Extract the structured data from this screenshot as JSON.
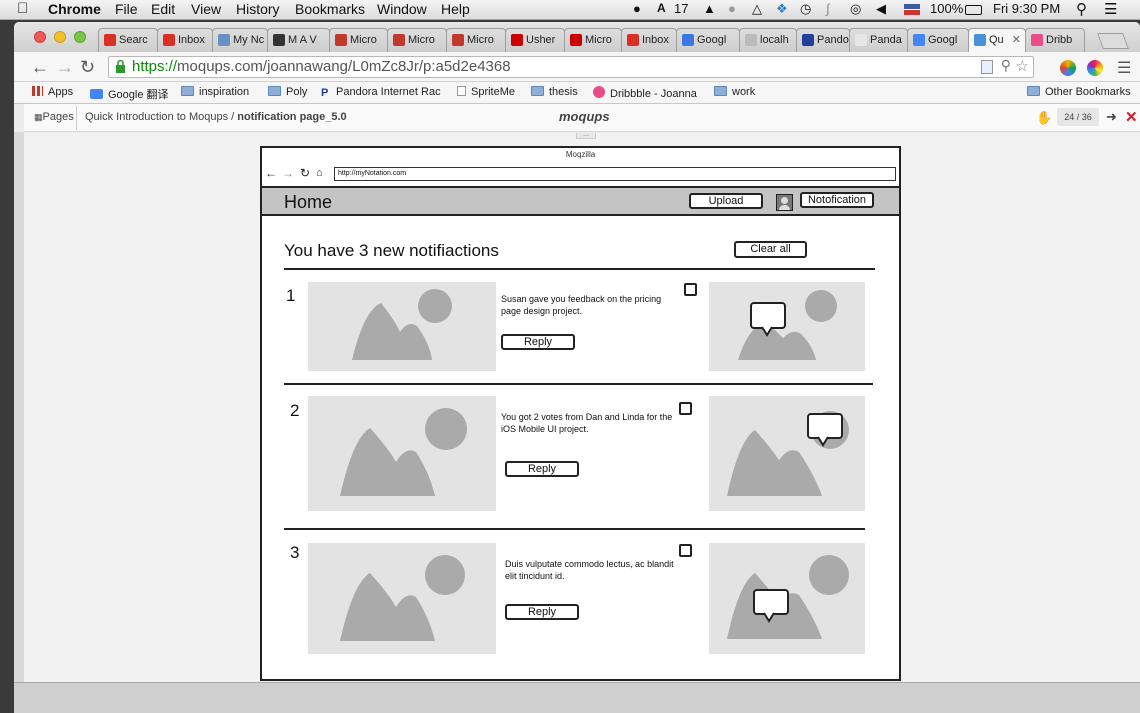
{
  "menubar": {
    "app": "Chrome",
    "menus": [
      "File",
      "Edit",
      "View",
      "History",
      "Bookmarks",
      "Window",
      "Help"
    ],
    "adobe_count": "17",
    "battery": "100%",
    "clock": "Fri 9:30 PM"
  },
  "tabs": [
    {
      "label": "Searc",
      "icon": "gmail-icon",
      "color": "#d93025"
    },
    {
      "label": "Inbox",
      "icon": "gmail-icon",
      "color": "#d93025"
    },
    {
      "label": "My Nc",
      "icon": "mynotation-icon",
      "color": "#6a8fc7"
    },
    {
      "label": "M A V",
      "icon": "mav-icon",
      "color": "#333333"
    },
    {
      "label": "Micro",
      "icon": "gear-icon",
      "color": "#c0392b"
    },
    {
      "label": "Micro",
      "icon": "gear-icon",
      "color": "#c0392b"
    },
    {
      "label": "Micro",
      "icon": "gear-icon",
      "color": "#c0392b"
    },
    {
      "label": "Usher",
      "icon": "youtube-icon",
      "color": "#cc0000"
    },
    {
      "label": "Micro",
      "icon": "youtube-icon",
      "color": "#cc0000"
    },
    {
      "label": "Inbox",
      "icon": "gmail-icon",
      "color": "#d93025"
    },
    {
      "label": "Googl",
      "icon": "calendar-icon",
      "color": "#3b78e7"
    },
    {
      "label": "localh",
      "icon": "page-icon",
      "color": "#bbbbbb"
    },
    {
      "label": "Pando",
      "icon": "pandora-icon",
      "color": "#224099"
    },
    {
      "label": "Panda",
      "icon": "page-icon",
      "color": "#e6e6e6"
    },
    {
      "label": "Googl",
      "icon": "translate-icon",
      "color": "#4285f4"
    },
    {
      "label": "Qu",
      "icon": "moqups-icon",
      "color": "#4a90d9",
      "active": true
    },
    {
      "label": "Dribb",
      "icon": "dribbble-icon",
      "color": "#ea4c89"
    }
  ],
  "address": {
    "scheme": "https://",
    "rest": "moqups.com/joannawang/L0mZc8Jr/p:a5d2e4368"
  },
  "bookmarks": [
    {
      "label": "Apps",
      "icon": "apps-grid-icon"
    },
    {
      "label": "Google 翻译",
      "icon": "translate-icon"
    },
    {
      "label": "inspiration",
      "icon": "folder-icon"
    },
    {
      "label": "Poly",
      "icon": "folder-icon"
    },
    {
      "label": "Pandora Internet Rac",
      "icon": "pandora-icon"
    },
    {
      "label": "SpriteMe",
      "icon": "page-icon"
    },
    {
      "label": "thesis",
      "icon": "folder-icon"
    },
    {
      "label": "Dribbble - Joanna",
      "icon": "dribbble-icon"
    },
    {
      "label": "work",
      "icon": "folder-icon"
    }
  ],
  "other_bookmarks": "Other Bookmarks",
  "appbar": {
    "pages_label": "Pages",
    "breadcrumb_root": "Quick Introduction to Moqups /",
    "breadcrumb_page": "notification page_5.0",
    "logo": "moqups",
    "page_counter": "24 / 36"
  },
  "mockup": {
    "window_title": "Moqzilla",
    "url": "http://myNotation.com",
    "home_title": "Home",
    "upload_label": "Upload",
    "notification_label": "Notofication",
    "headline": "You have 3 new notifiactions",
    "clear_all_label": "Clear all",
    "notifications": [
      {
        "number": "1",
        "text": "Susan gave you feedback on the pricing page design project.",
        "reply": "Reply"
      },
      {
        "number": "2",
        "text": "You got 2 votes from Dan and Linda for the iOS Mobile UI project.",
        "reply": "Reply"
      },
      {
        "number": "3",
        "text": "Duis vulputate commodo lectus, ac blandit elit tincidunt id.",
        "reply": "Reply"
      }
    ]
  }
}
